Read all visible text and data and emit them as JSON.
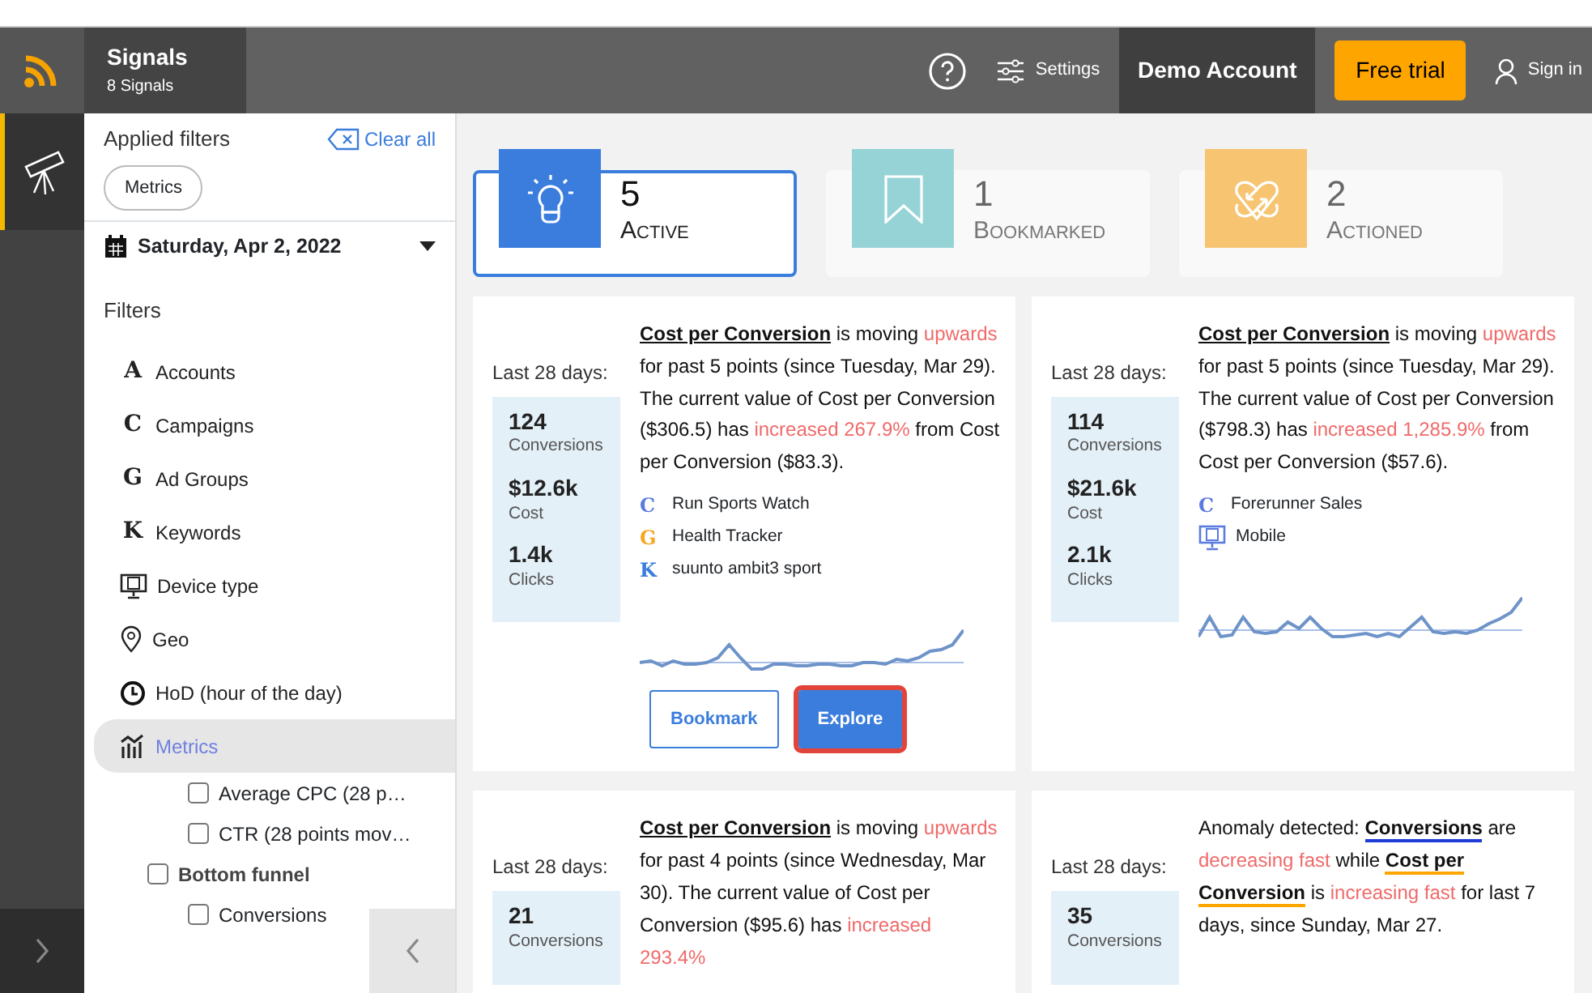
{
  "app": {
    "title": "Signals",
    "subtitle": "8 Signals"
  },
  "topbar": {
    "settings": "Settings",
    "account": "Demo Account",
    "trial": "Free trial",
    "signin": "Sign in"
  },
  "rail": {
    "items": [
      {
        "kind": "telescope",
        "selected": true
      }
    ]
  },
  "sidebar": {
    "applied_title": "Applied filters",
    "clear": "Clear all",
    "chips": [
      "Metrics"
    ],
    "date": "Saturday, Apr 2, 2022",
    "filters_title": "Filters",
    "items": [
      {
        "kind": "letter",
        "letter": "A",
        "label": "Accounts",
        "selected": false
      },
      {
        "kind": "letter",
        "letter": "C",
        "label": "Campaigns",
        "selected": false
      },
      {
        "kind": "letter",
        "letter": "G",
        "label": "Ad Groups",
        "selected": false
      },
      {
        "kind": "letter",
        "letter": "K",
        "label": "Keywords",
        "selected": false
      },
      {
        "kind": "device",
        "label": "Device type",
        "selected": false
      },
      {
        "kind": "geo",
        "label": "Geo",
        "selected": false
      },
      {
        "kind": "clock",
        "label": "HoD (hour of the day)",
        "selected": false
      },
      {
        "kind": "metrics",
        "label": "Metrics",
        "selected": true,
        "expanded": true,
        "children": [
          {
            "children": [
              {
                "label": "Average CPC (28 p…",
                "checked": false
              },
              {
                "label": "CTR (28 points mov…",
                "checked": false
              }
            ]
          },
          {
            "label": "Bottom funnel",
            "checked": false,
            "children": [
              {
                "label": "Conversions",
                "checked": false
              }
            ]
          }
        ]
      }
    ]
  },
  "tiles": [
    {
      "kind": "active",
      "count": "5",
      "label": "Active",
      "selected": true
    },
    {
      "kind": "bookmarked",
      "count": "1",
      "label": "Bookmarked",
      "selected": false
    },
    {
      "kind": "actioned",
      "count": "2",
      "label": "Actioned",
      "selected": false
    }
  ],
  "cards": [
    {
      "period": "Last 28 days:",
      "stats": [
        {
          "value": "124",
          "label": "Conversions"
        },
        {
          "value": "$12.6k",
          "label": "Cost"
        },
        {
          "value": "1.4k",
          "label": "Clicks"
        }
      ],
      "text": [
        {
          "kind": "metric",
          "text": "Cost per Conversion"
        },
        {
          "kind": "plain",
          "text": " is moving "
        },
        {
          "kind": "trend",
          "text": "upwards"
        },
        {
          "kind": "plain",
          "text": " for past 5 points (since Tuesday, Mar 29). The current value of Cost per Conversion ($306.5) has "
        },
        {
          "kind": "trend",
          "text": "increased 267.9%"
        },
        {
          "kind": "plain",
          "text": " from Cost per Conversion ($83.3)."
        }
      ],
      "entities": [
        {
          "kind": "campaign",
          "letter": "C",
          "label": "Run Sports Watch"
        },
        {
          "kind": "adgroup",
          "letter": "G",
          "label": "Health Tracker"
        },
        {
          "kind": "keyword",
          "letter": "K",
          "label": "suunto ambit3 sport"
        }
      ],
      "sparkline": true,
      "buttons": [
        {
          "kind": "outline",
          "label": "Bookmark"
        },
        {
          "kind": "primary",
          "label": "Explore",
          "focused": true
        }
      ]
    },
    {
      "period": "Last 28 days:",
      "stats": [
        {
          "value": "114",
          "label": "Conversions"
        },
        {
          "value": "$21.6k",
          "label": "Cost"
        },
        {
          "value": "2.1k",
          "label": "Clicks"
        }
      ],
      "text": [
        {
          "kind": "metric",
          "text": "Cost per Conversion"
        },
        {
          "kind": "plain",
          "text": " is moving "
        },
        {
          "kind": "trend",
          "text": "upwards"
        },
        {
          "kind": "plain",
          "text": " for past 5 points (since Tuesday, Mar 29). The current value of Cost per Conversion ($798.3) has "
        },
        {
          "kind": "trend",
          "text": "increased 1,285.9%"
        },
        {
          "kind": "plain",
          "text": " from Cost per Conversion ($57.6)."
        }
      ],
      "entities": [
        {
          "kind": "campaign",
          "letter": "C",
          "label": "Forerunner Sales"
        },
        {
          "kind": "device",
          "label": "Mobile"
        }
      ],
      "sparkline": true
    },
    {
      "period": "Last 28 days:",
      "stats": [
        {
          "value": "21",
          "label": "Conversions"
        }
      ],
      "text": [
        {
          "kind": "metric",
          "text": "Cost per Conversion"
        },
        {
          "kind": "plain",
          "text": " is moving "
        },
        {
          "kind": "trend",
          "text": "upwards"
        },
        {
          "kind": "plain",
          "text": " for past 4 points (since Wednesday, Mar 30). The current value of Cost per Conversion ($95.6) has "
        },
        {
          "kind": "trend",
          "text": "increased 293.4%"
        }
      ]
    },
    {
      "period": "Last 28 days:",
      "stats": [
        {
          "value": "35",
          "label": "Conversions"
        }
      ],
      "text": [
        {
          "kind": "plain",
          "text": "Anomaly detected: "
        },
        {
          "kind": "metric-blue",
          "text": "Conversions"
        },
        {
          "kind": "plain",
          "text": " are "
        },
        {
          "kind": "trend",
          "text": "decreasing fast"
        },
        {
          "kind": "plain",
          "text": " while "
        },
        {
          "kind": "metric-orange",
          "text": "Cost per Conversion"
        },
        {
          "kind": "plain",
          "text": " is "
        },
        {
          "kind": "trend",
          "text": "increasing fast"
        },
        {
          "kind": "plain",
          "text": " for last 7 days, since Sunday, Mar 27."
        }
      ]
    }
  ]
}
